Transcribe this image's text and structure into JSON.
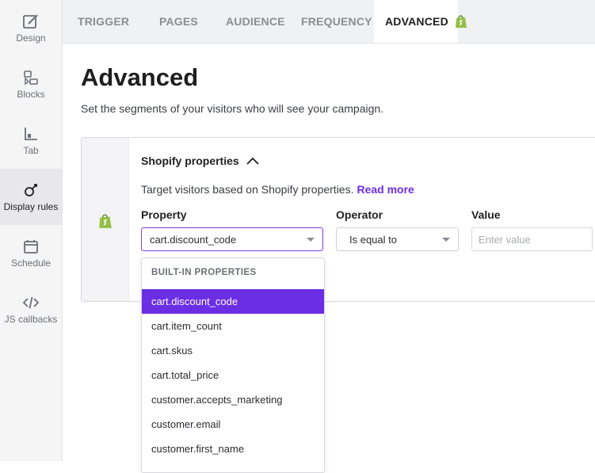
{
  "rail": {
    "items": [
      {
        "label": "Design",
        "icon": "design-icon"
      },
      {
        "label": "Blocks",
        "icon": "blocks-icon"
      },
      {
        "label": "Tab",
        "icon": "tab-icon"
      },
      {
        "label": "Display rules",
        "icon": "display-rules-icon",
        "active": true
      },
      {
        "label": "Schedule",
        "icon": "schedule-icon"
      },
      {
        "label": "JS callbacks",
        "icon": "code-icon"
      }
    ]
  },
  "tabs": [
    "TRIGGER",
    "PAGES",
    "AUDIENCE",
    "FREQUENCY",
    "ADVANCED"
  ],
  "active_tab": "ADVANCED",
  "page": {
    "title": "Advanced",
    "subtitle": "Set the segments of your visitors who will see your campaign."
  },
  "section": {
    "title": "Shopify properties",
    "description": "Target visitors based on Shopify properties.",
    "read_more": "Read more",
    "property_label": "Property",
    "operator_label": "Operator",
    "value_label": "Value",
    "property_value": "cart.discount_code",
    "operator_value": "Is equal to",
    "value_placeholder": "Enter value"
  },
  "dropdown": {
    "header": "BUILT-IN PROPERTIES",
    "items": [
      "cart.discount_code",
      "cart.item_count",
      "cart.skus",
      "cart.total_price",
      "customer.accepts_marketing",
      "customer.email",
      "customer.first_name"
    ],
    "selected": "cart.discount_code"
  },
  "colors": {
    "accent": "#6c2ee4",
    "link": "#6d2ee5",
    "shopify_green": "#95bf47"
  }
}
